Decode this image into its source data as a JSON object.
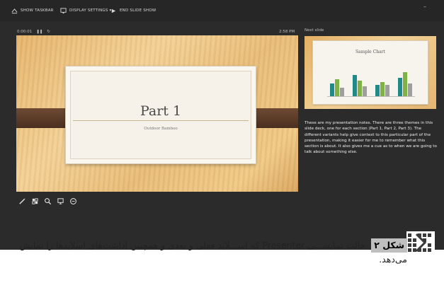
{
  "toolbar": {
    "show_taskbar": "SHOW TASKBAR",
    "display_settings": "DISPLAY SETTINGS ▾",
    "end_slide_show": "END SLIDE SHOW"
  },
  "status": {
    "timer": "0:00:01",
    "time": "2:58 PM"
  },
  "current_slide": {
    "title": "Part 1",
    "subtitle": "Outdoor Bamboo"
  },
  "next_slide": {
    "label": "Next slide",
    "title": "Sample Chart"
  },
  "notes": "These are my presentation notes.  There are three themes in this slide deck, one for each section (Part 1, Part 2, Part 3).  The different variants help give context to this particular part of the presentation, making it easier for me to remember what this section is about.  It also gives me a cue as to when we are going to talk about something else.",
  "tools": [
    "pen-tool-icon",
    "see-all-slides-icon",
    "zoom-icon",
    "display-icon",
    "more-options-icon"
  ],
  "caption": {
    "label": "شکل ۲",
    "text": "حالت نمایشـــی Presenter که اســـلاید فعلی و بعدی و همچنین اداشت‌های اسلایدها را نمایش می‌دهد."
  },
  "colors": {
    "app_bg": "#2b2b2b",
    "chart_teal": "#1f8a8a",
    "chart_green": "#7cb342",
    "chart_gray": "#9e9e9e"
  }
}
